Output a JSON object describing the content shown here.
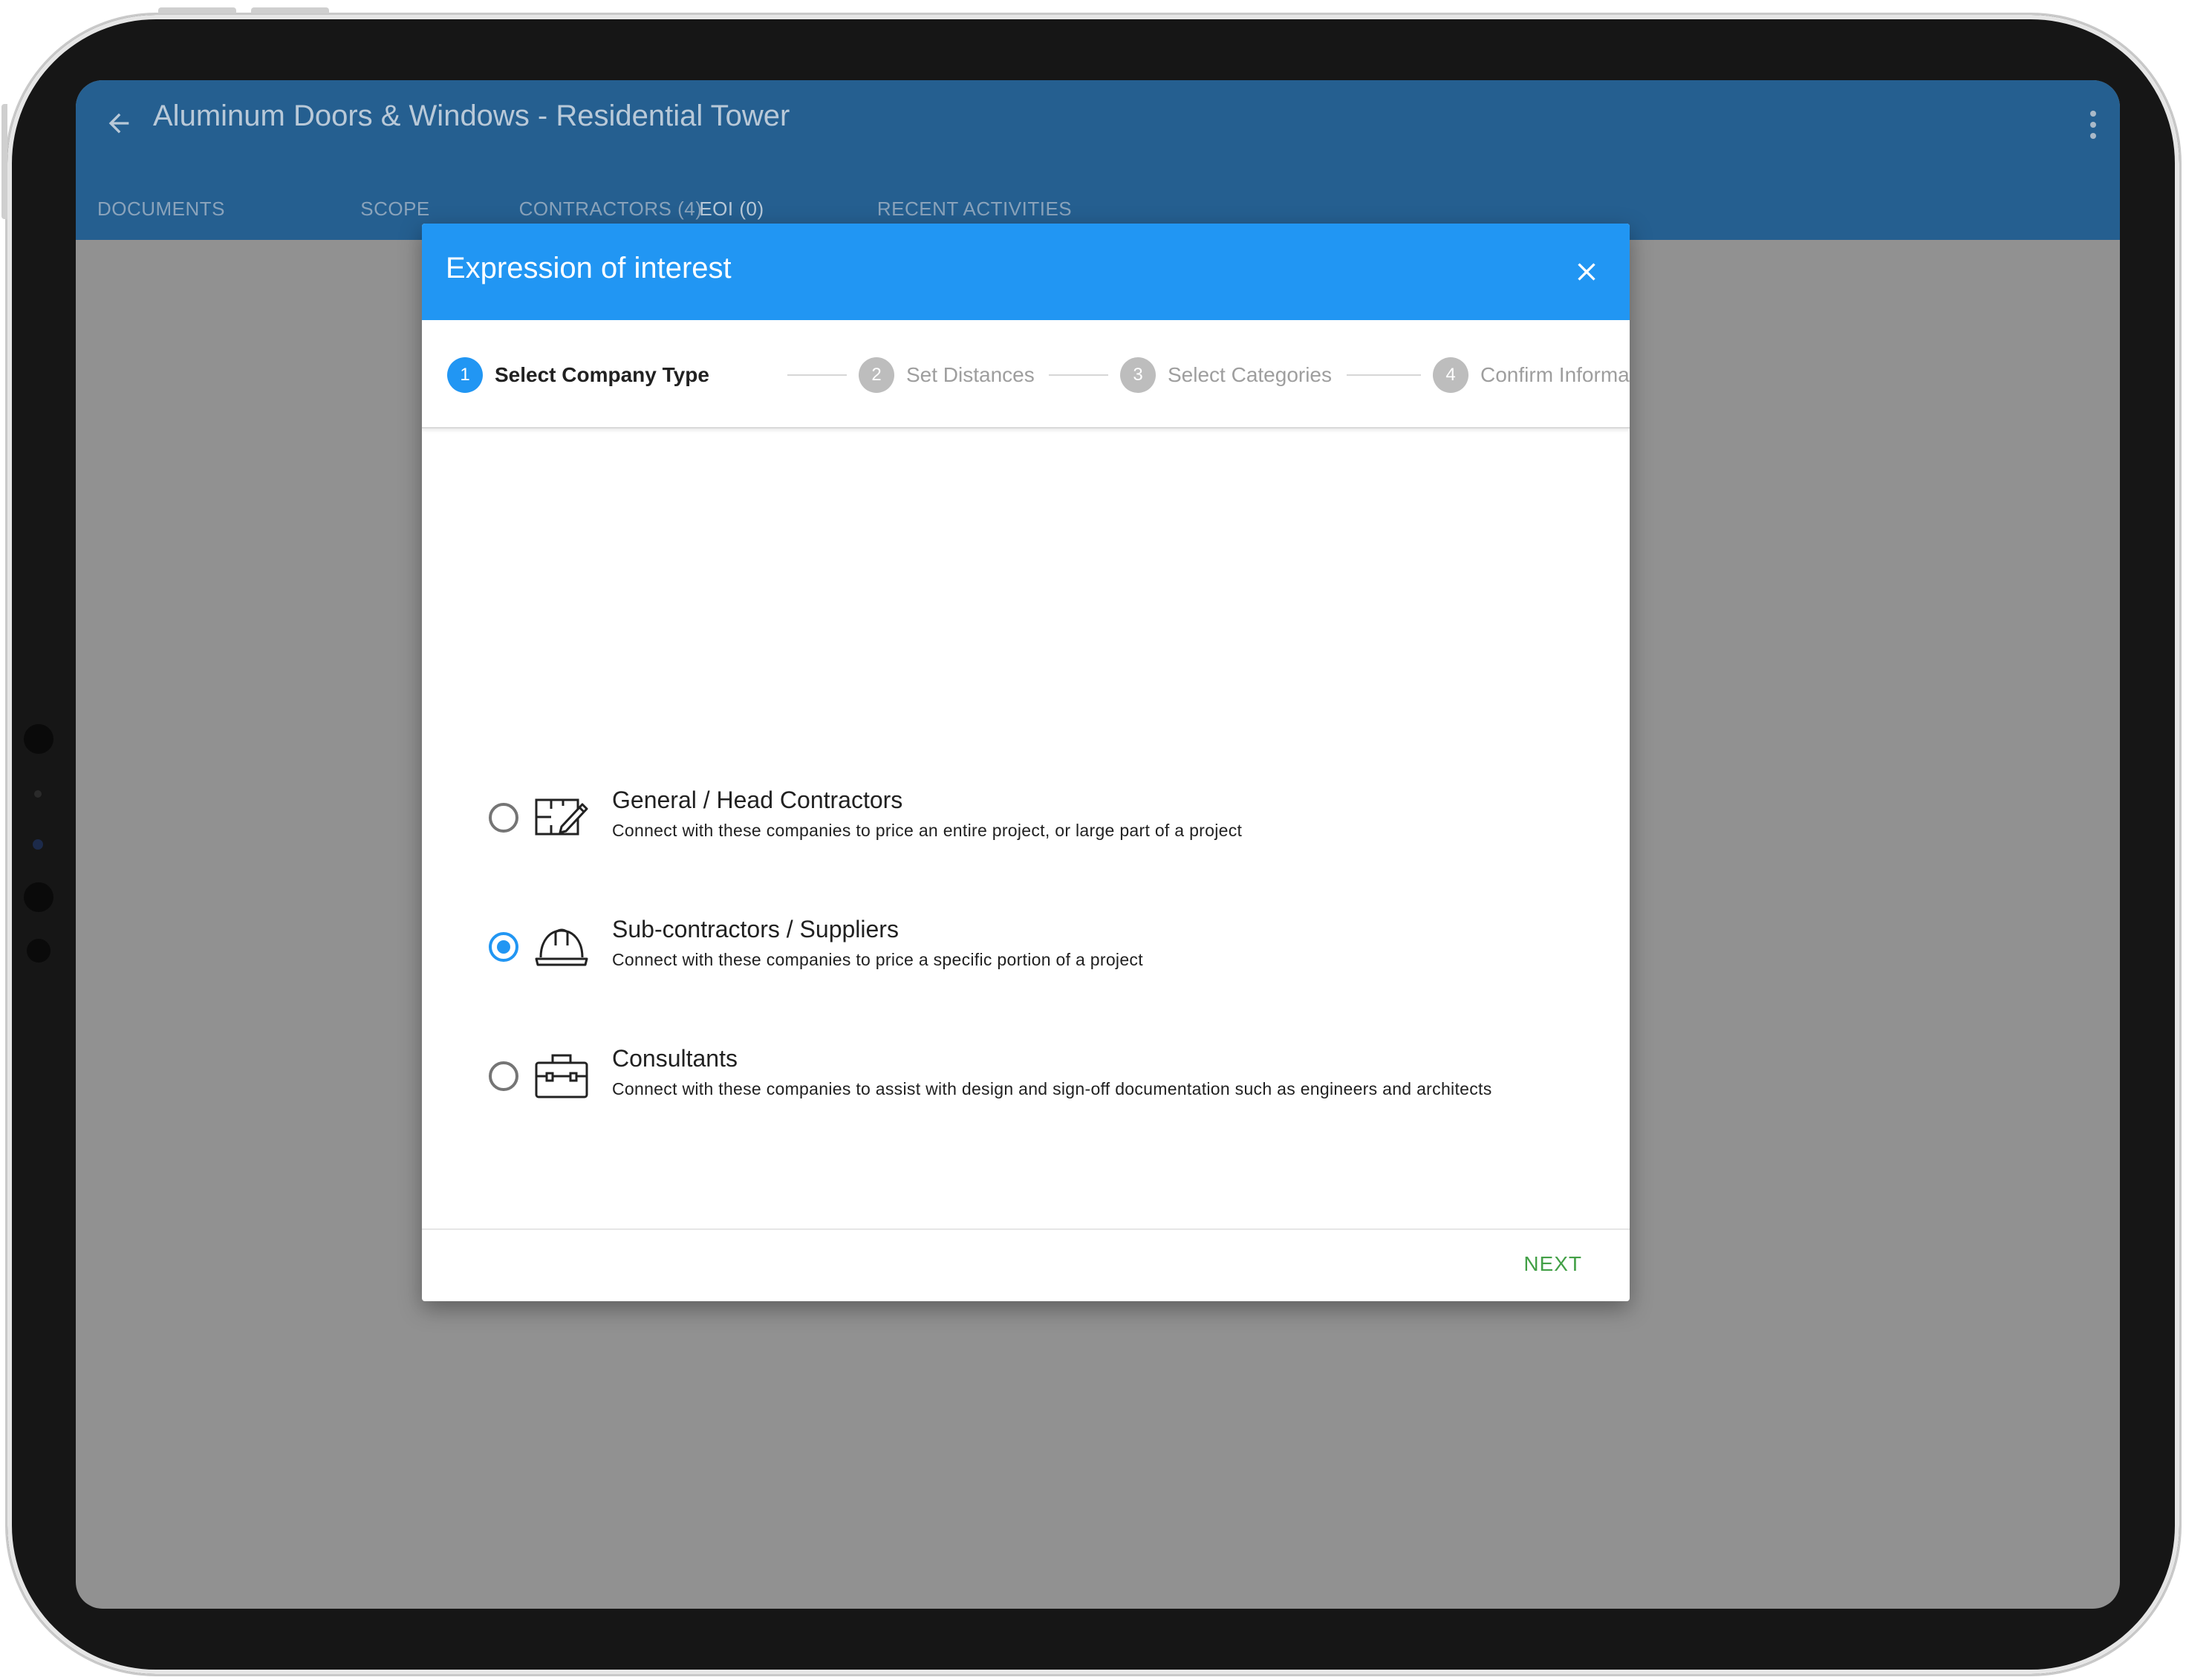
{
  "app": {
    "title": "Aluminum Doors & Windows - Residential Tower",
    "tabs": [
      {
        "label": "DOCUMENTS",
        "active": false
      },
      {
        "label": "SCOPE",
        "active": false
      },
      {
        "label": "CONTRACTORS (4)",
        "active": false
      },
      {
        "label": "EOI (0)",
        "active": true
      },
      {
        "label": "RECENT ACTIVITIES",
        "active": false
      }
    ]
  },
  "dialog": {
    "title": "Expression of interest",
    "steps": [
      {
        "number": "1",
        "label": "Select Company Type",
        "active": true
      },
      {
        "number": "2",
        "label": "Set Distances",
        "active": false
      },
      {
        "number": "3",
        "label": "Select Categories",
        "active": false
      },
      {
        "number": "4",
        "label": "Confirm Information",
        "active": false
      }
    ],
    "options": [
      {
        "title": "General / Head Contractors",
        "description": "Connect with these companies to price an entire project, or large part of a project",
        "icon": "blueprint-pencil-icon",
        "selected": false
      },
      {
        "title": "Sub-contractors / Suppliers",
        "description": "Connect with these companies to price a specific portion of a project",
        "icon": "hard-hat-icon",
        "selected": true
      },
      {
        "title": "Consultants",
        "description": "Connect with these companies to assist with design and sign-off documentation such as engineers and architects",
        "icon": "briefcase-icon",
        "selected": false
      }
    ],
    "next_label": "NEXT"
  },
  "colors": {
    "app_bar": "#255f90",
    "dialog_header": "#2196f3",
    "accent": "#2196f3",
    "next": "#43a047",
    "overlay": "#919191"
  }
}
